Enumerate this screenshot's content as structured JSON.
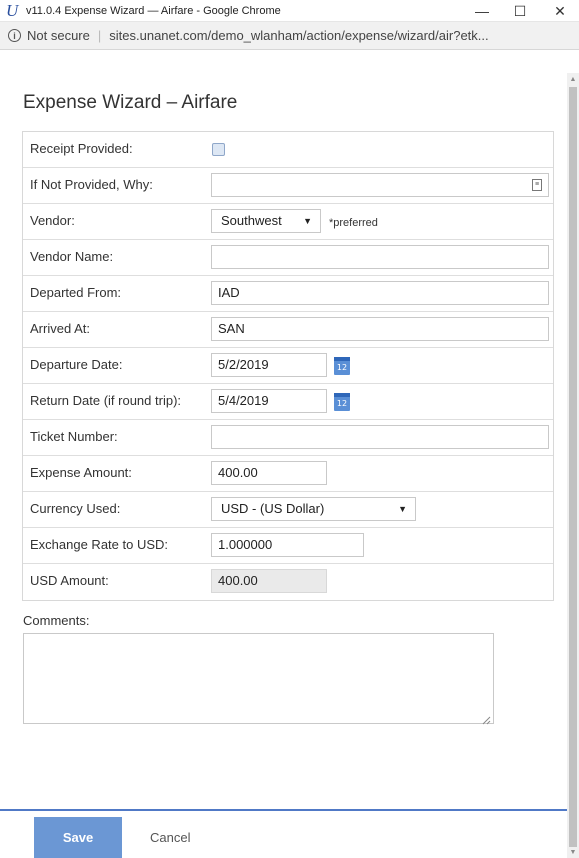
{
  "window": {
    "title": "v11.0.4 Expense Wizard — Airfare - Google Chrome",
    "logo_letter": "U",
    "minimize": "—",
    "maximize": "☐",
    "close": "✕"
  },
  "address": {
    "security": "Not secure",
    "url": "sites.unanet.com/demo_wlanham/action/expense/wizard/air?etk..."
  },
  "page": {
    "title": "Expense Wizard – Airfare"
  },
  "form": {
    "receipt_label": "Receipt Provided:",
    "receipt_checked": false,
    "why_label": "If Not Provided, Why:",
    "why_value": "",
    "vendor_label": "Vendor:",
    "vendor_value": "Southwest",
    "vendor_note": "*preferred",
    "vendor_name_label": "Vendor Name:",
    "vendor_name_value": "",
    "departed_label": "Departed From:",
    "departed_value": "IAD",
    "arrived_label": "Arrived At:",
    "arrived_value": "SAN",
    "departure_date_label": "Departure Date:",
    "departure_date_value": "5/2/2019",
    "return_date_label": "Return Date (if round trip):",
    "return_date_value": "5/4/2019",
    "calendar_day": "12",
    "ticket_label": "Ticket Number:",
    "ticket_value": "",
    "amount_label": "Expense Amount:",
    "amount_value": "400.00",
    "currency_label": "Currency Used:",
    "currency_value": "USD - (US Dollar)",
    "exchange_label": "Exchange Rate to USD:",
    "exchange_value": "1.000000",
    "usd_label": "USD Amount:",
    "usd_value": "400.00"
  },
  "comments": {
    "label": "Comments:",
    "value": ""
  },
  "footer": {
    "save_label": "Save",
    "cancel_label": "Cancel"
  },
  "colors": {
    "accent": "#6b97d4",
    "footer_rule": "#5079c6"
  }
}
